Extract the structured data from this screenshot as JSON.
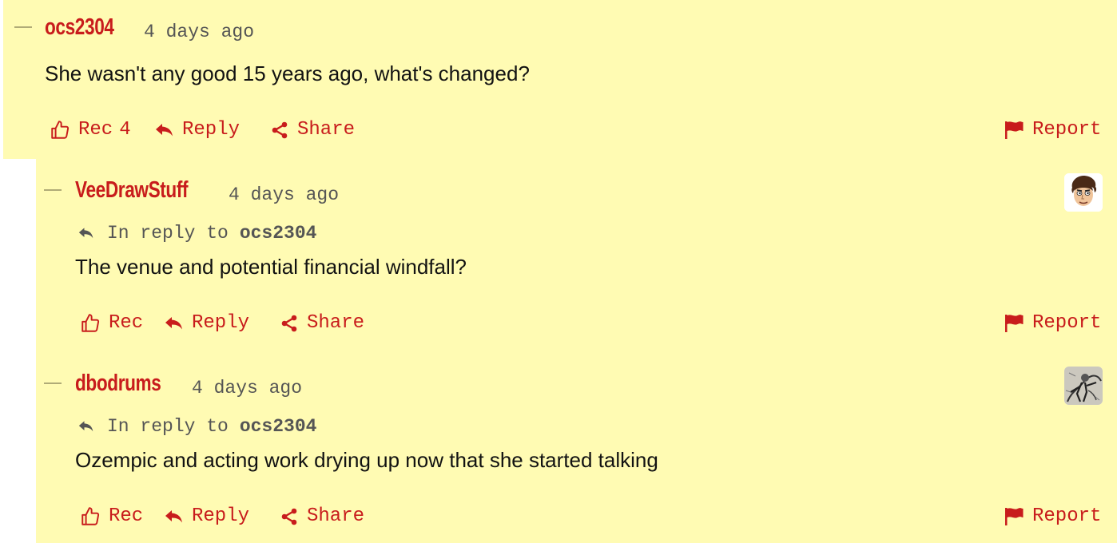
{
  "comments": [
    {
      "username": "ocs2304",
      "timestamp": "4 days ago",
      "body": "She wasn't any good 15 years ago, what's changed?",
      "rec_label": "Rec",
      "rec_count": "4",
      "reply_label": "Reply",
      "share_label": "Share",
      "report_label": "Report"
    },
    {
      "username": "VeeDrawStuff",
      "timestamp": "4 days ago",
      "in_reply_prefix": "In reply to",
      "in_reply_user": "ocs2304",
      "body": "The venue and potential financial windfall?",
      "rec_label": "Rec",
      "reply_label": "Reply",
      "share_label": "Share",
      "report_label": "Report",
      "avatar": "cartoon-face-avatar"
    },
    {
      "username": "dbodrums",
      "timestamp": "4 days ago",
      "in_reply_prefix": "In reply to",
      "in_reply_user": "ocs2304",
      "body": "Ozempic and acting work drying up now that she started talking",
      "rec_label": "Rec",
      "reply_label": "Reply",
      "share_label": "Share",
      "report_label": "Report",
      "avatar": "sketch-figure-avatar"
    }
  ],
  "colors": {
    "accent": "#c81c1c",
    "highlight": "#fffbb3",
    "text": "#121212",
    "muted": "#555555"
  }
}
